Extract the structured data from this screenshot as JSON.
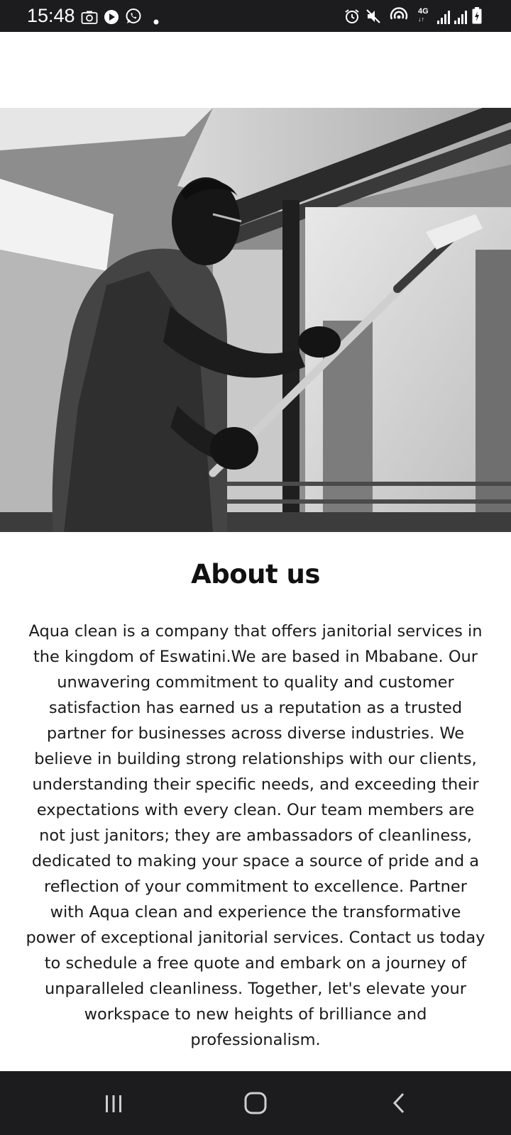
{
  "status_bar": {
    "time": "15:48",
    "left_icons": [
      "camera-icon",
      "play-icon",
      "whatsapp-icon",
      "dot-icon"
    ],
    "right_icons": [
      "alarm-icon",
      "mute-icon",
      "hotspot-icon",
      "4g-icon",
      "signal-icon",
      "signal-icon",
      "battery-icon"
    ],
    "network_label": "4G"
  },
  "hero": {
    "image_description": "hero-photo"
  },
  "about": {
    "title": "About us",
    "body": "Aqua clean is a company that offers janitorial services in the kingdom of Eswatini.We are based in Mbabane. Our unwavering commitment to quality and customer satisfaction has earned us a reputation as a trusted partner for businesses across diverse industries. We believe in building strong relationships with our clients, understanding their specific needs, and exceeding their expectations with every clean. Our team members are not just janitors; they are ambassadors of cleanliness, dedicated to making your space a source of pride and a reflection of your commitment to excellence. Partner with Aqua clean and experience the transformative power of exceptional janitorial services. Contact us today to schedule a free quote and embark on a journey of unparalleled cleanliness. Together, let's elevate your workspace to new heights of brilliance and professionalism."
  },
  "nav_bar": {
    "buttons": [
      "recents-icon",
      "home-icon",
      "back-icon"
    ]
  },
  "colors": {
    "status_bar_bg": "#1c1c1e",
    "nav_bar_bg": "#1c1c1e",
    "page_bg": "#ffffff",
    "text": "#1a1a1a"
  }
}
